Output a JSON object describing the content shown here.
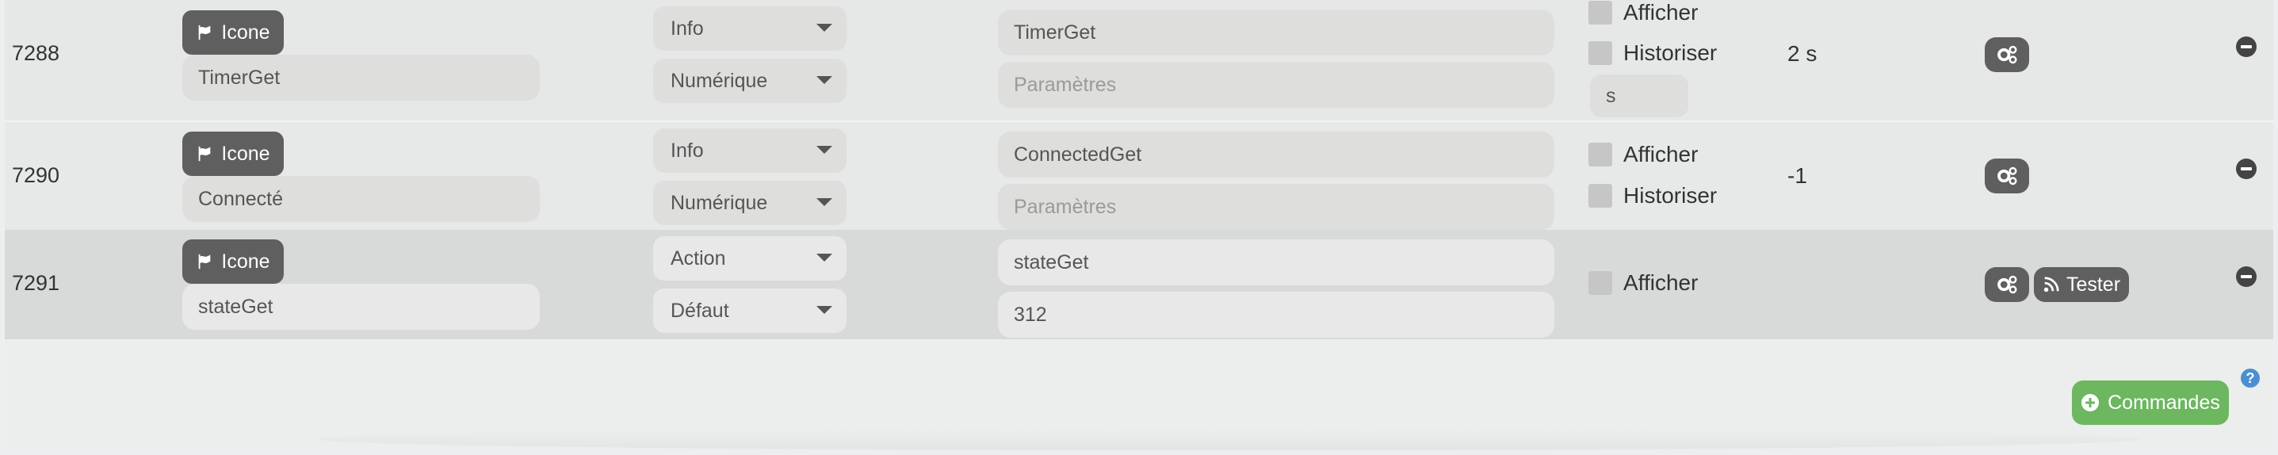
{
  "commands": [
    {
      "id": "7288",
      "icon_label": "Icone",
      "name": "TimerGet",
      "type": "Info",
      "subtype": "Numérique",
      "logical_id": "TimerGet",
      "params_placeholder": "Paramètres",
      "afficher": "Afficher",
      "historiser": "Historiser",
      "unit": "s",
      "value": "2 s"
    },
    {
      "id": "7290",
      "icon_label": "Icone",
      "name": "Connecté",
      "type": "Info",
      "subtype": "Numérique",
      "logical_id": "ConnectedGet",
      "params_placeholder": "Paramètres",
      "afficher": "Afficher",
      "historiser": "Historiser",
      "value": "-1"
    },
    {
      "id": "7291",
      "icon_label": "Icone",
      "name": "stateGet",
      "type": "Action",
      "subtype": "Défaut",
      "logical_id": "stateGet",
      "params_value": "312",
      "afficher": "Afficher",
      "test_label": "Tester"
    }
  ],
  "footer": {
    "add_commands_label": "Commandes",
    "help_label": "?"
  },
  "colors": {
    "dark_button": "#5f5f5f",
    "success": "#6cb75f",
    "help": "#4b8fd1"
  },
  "icons": [
    "flag-icon",
    "gears-icon",
    "rss-icon",
    "minus-circle-icon",
    "plus-circle-icon",
    "question-circle-icon"
  ]
}
